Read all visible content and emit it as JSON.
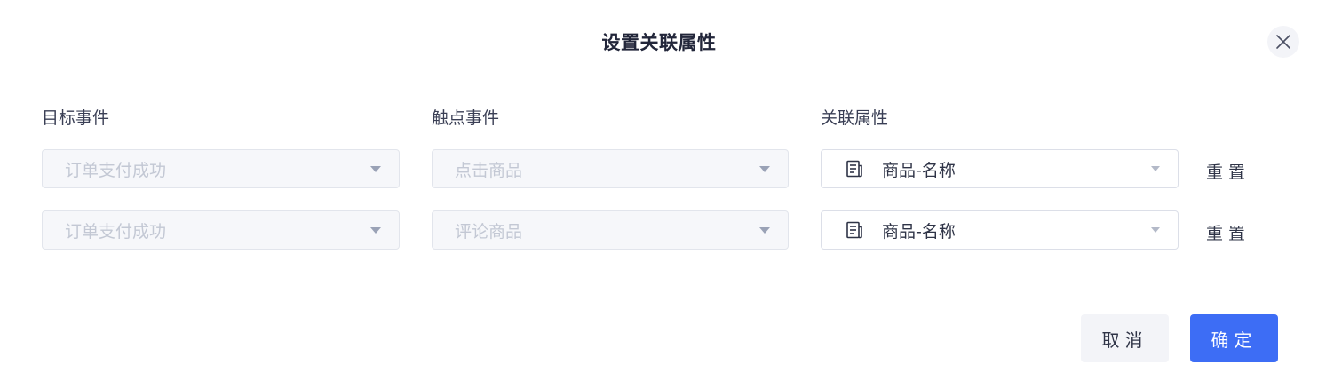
{
  "dialog": {
    "title": "设置关联属性",
    "close_icon": "close-icon"
  },
  "columns": {
    "target_event": "目标事件",
    "touchpoint_event": "触点事件",
    "related_attribute": "关联属性"
  },
  "rows": [
    {
      "target_event": "订单支付成功",
      "touchpoint_event": "点击商品",
      "related_attribute": "商品-名称",
      "reset_label": "重置"
    },
    {
      "target_event": "订单支付成功",
      "touchpoint_event": "评论商品",
      "related_attribute": "商品-名称",
      "reset_label": "重置"
    }
  ],
  "footer": {
    "cancel_label": "取消",
    "confirm_label": "确定"
  },
  "colors": {
    "primary": "#3d6df5",
    "disabled_text": "#c3c8d4",
    "text": "#2f3447"
  }
}
